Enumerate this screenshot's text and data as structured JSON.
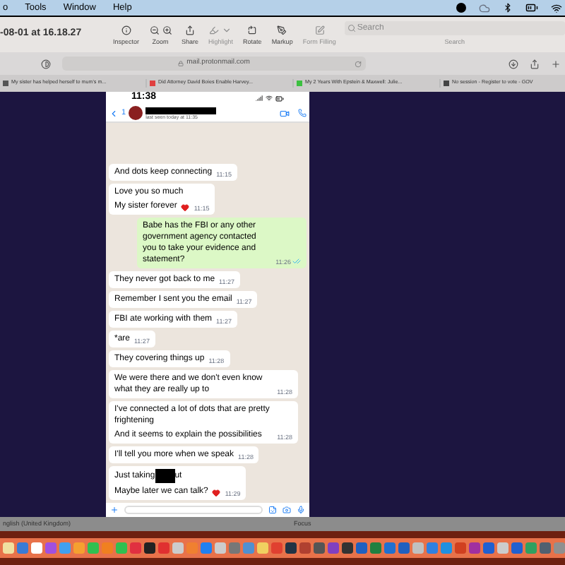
{
  "menu_bar": {
    "items": [
      "o",
      "Tools",
      "Window",
      "Help"
    ]
  },
  "preview_toolbar": {
    "title": "-08-01 at 16.18.27",
    "tools": [
      {
        "kind": "info",
        "label": "Inspector",
        "disabled": false
      },
      {
        "kind": "zoom",
        "label": "Zoom",
        "disabled": false
      },
      {
        "kind": "share",
        "label": "Share",
        "disabled": false
      },
      {
        "kind": "highlight",
        "label": "Highlight",
        "disabled": true
      },
      {
        "kind": "rotate",
        "label": "Rotate",
        "disabled": false
      },
      {
        "kind": "markup",
        "label": "Markup",
        "disabled": false
      },
      {
        "kind": "form",
        "label": "Form Filling",
        "disabled": true
      }
    ],
    "search": {
      "placeholder": "Search",
      "label": "Search"
    }
  },
  "browser": {
    "url": "mail.protonmail.com",
    "bookmarks": [
      {
        "label": "My sister has helped herself to mum's m...",
        "color": "#555555"
      },
      {
        "label": "Did Attorney David Boies Enable Harvey...",
        "color": "#e04040"
      },
      {
        "label": "My 2 Years With Epstein & Maxwell: Julie...",
        "color": "#3cc040"
      },
      {
        "label": "No session - Register to vote - GOV",
        "color": "#444444"
      }
    ]
  },
  "phone": {
    "time": "11:38",
    "back_count": "1",
    "last_seen": "last seen today at 11:35",
    "messages": [
      {
        "kind": "incoming",
        "time": "11:15",
        "lines": [
          {
            "text": "And dots keep connecting"
          }
        ]
      },
      {
        "kind": "incoming",
        "time": "11:15",
        "lines": [
          {
            "text": "Love you so much"
          },
          {
            "text": "My sister forever",
            "heart": true
          }
        ]
      },
      {
        "kind": "outgoing",
        "time": "11:26",
        "read": true,
        "lines": [
          {
            "text": "Babe has the FBI or any other government agency contacted you to take your evidence and statement?"
          }
        ]
      },
      {
        "kind": "incoming",
        "time": "11:27",
        "lines": [
          {
            "text": "They never got back to me"
          }
        ]
      },
      {
        "kind": "incoming",
        "time": "11:27",
        "lines": [
          {
            "text": "Remember I sent you the email"
          }
        ]
      },
      {
        "kind": "incoming",
        "time": "11:27",
        "lines": [
          {
            "text": "FBI ate working with them"
          }
        ]
      },
      {
        "kind": "incoming",
        "time": "11:27",
        "lines": [
          {
            "text": "*are"
          }
        ]
      },
      {
        "kind": "incoming",
        "time": "11:28",
        "lines": [
          {
            "text": "They covering things up"
          }
        ]
      },
      {
        "kind": "incoming",
        "time": "11:28",
        "lines": [
          {
            "text": "We were there and we don't even know what they are really up to"
          }
        ]
      },
      {
        "kind": "incoming",
        "time": "11:28",
        "lines": [
          {
            "text": "I've connected a lot of dots that are pretty frightening"
          },
          {
            "text": "And it seems to explain the possibilities"
          }
        ]
      },
      {
        "kind": "incoming",
        "time": "11:28",
        "lines": [
          {
            "text": "I'll tell you more when we speak"
          }
        ]
      },
      {
        "kind": "incoming",
        "time": "11:29",
        "lines": [
          {
            "text": "Just taking",
            "redacted": true,
            "after": "ut"
          },
          {
            "text": "Maybe later we can talk?",
            "heart": true
          }
        ]
      }
    ]
  },
  "status_bar": {
    "language": "nglish (United Kingdom)",
    "focus": "Focus"
  }
}
